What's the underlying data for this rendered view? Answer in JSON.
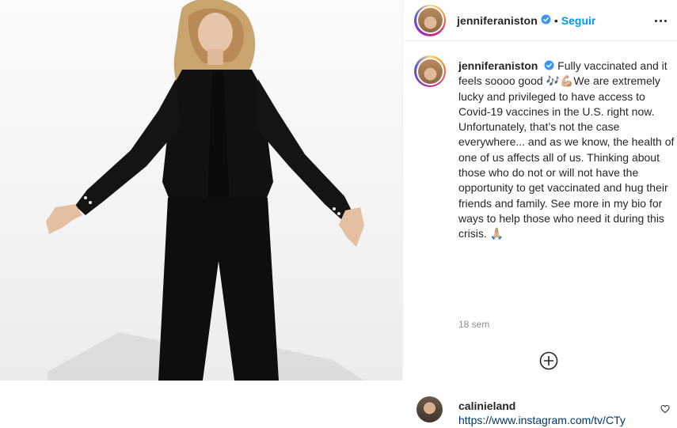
{
  "post": {
    "image_alt": "Photo of woman in black outfit with arms outstretched",
    "header": {
      "username": "jenniferaniston",
      "separator": "•",
      "follow_label": "Seguir"
    },
    "caption": {
      "username": "jenniferaniston",
      "text": "Fully vaccinated and it feels soooo good 🎶💪🏼We are extremely lucky and privileged to have access to Covid-19 vaccines in the U.S. right now. Unfortunately, that’s not the case everywhere... and as we know, the health of one of us affects all of us. Thinking about those who do not or will not have the opportunity to get vaccinated and hug their friends and family. See more in my bio for ways to help those who need it during this crisis. 🙏🏼"
    },
    "timestamp": "18 sem",
    "comments": [
      {
        "username": "calinieland",
        "text": "https://www.instagram.com/tv/CTy"
      }
    ]
  },
  "colors": {
    "accent": "#0095f6",
    "verified": "#3897f0",
    "muted": "#8e8e8e",
    "text": "#262626",
    "link": "#00376b"
  },
  "icons": {
    "verified": "verified-badge-icon",
    "more": "more-options-icon",
    "load_more": "plus-circle-icon",
    "like": "heart-icon"
  }
}
